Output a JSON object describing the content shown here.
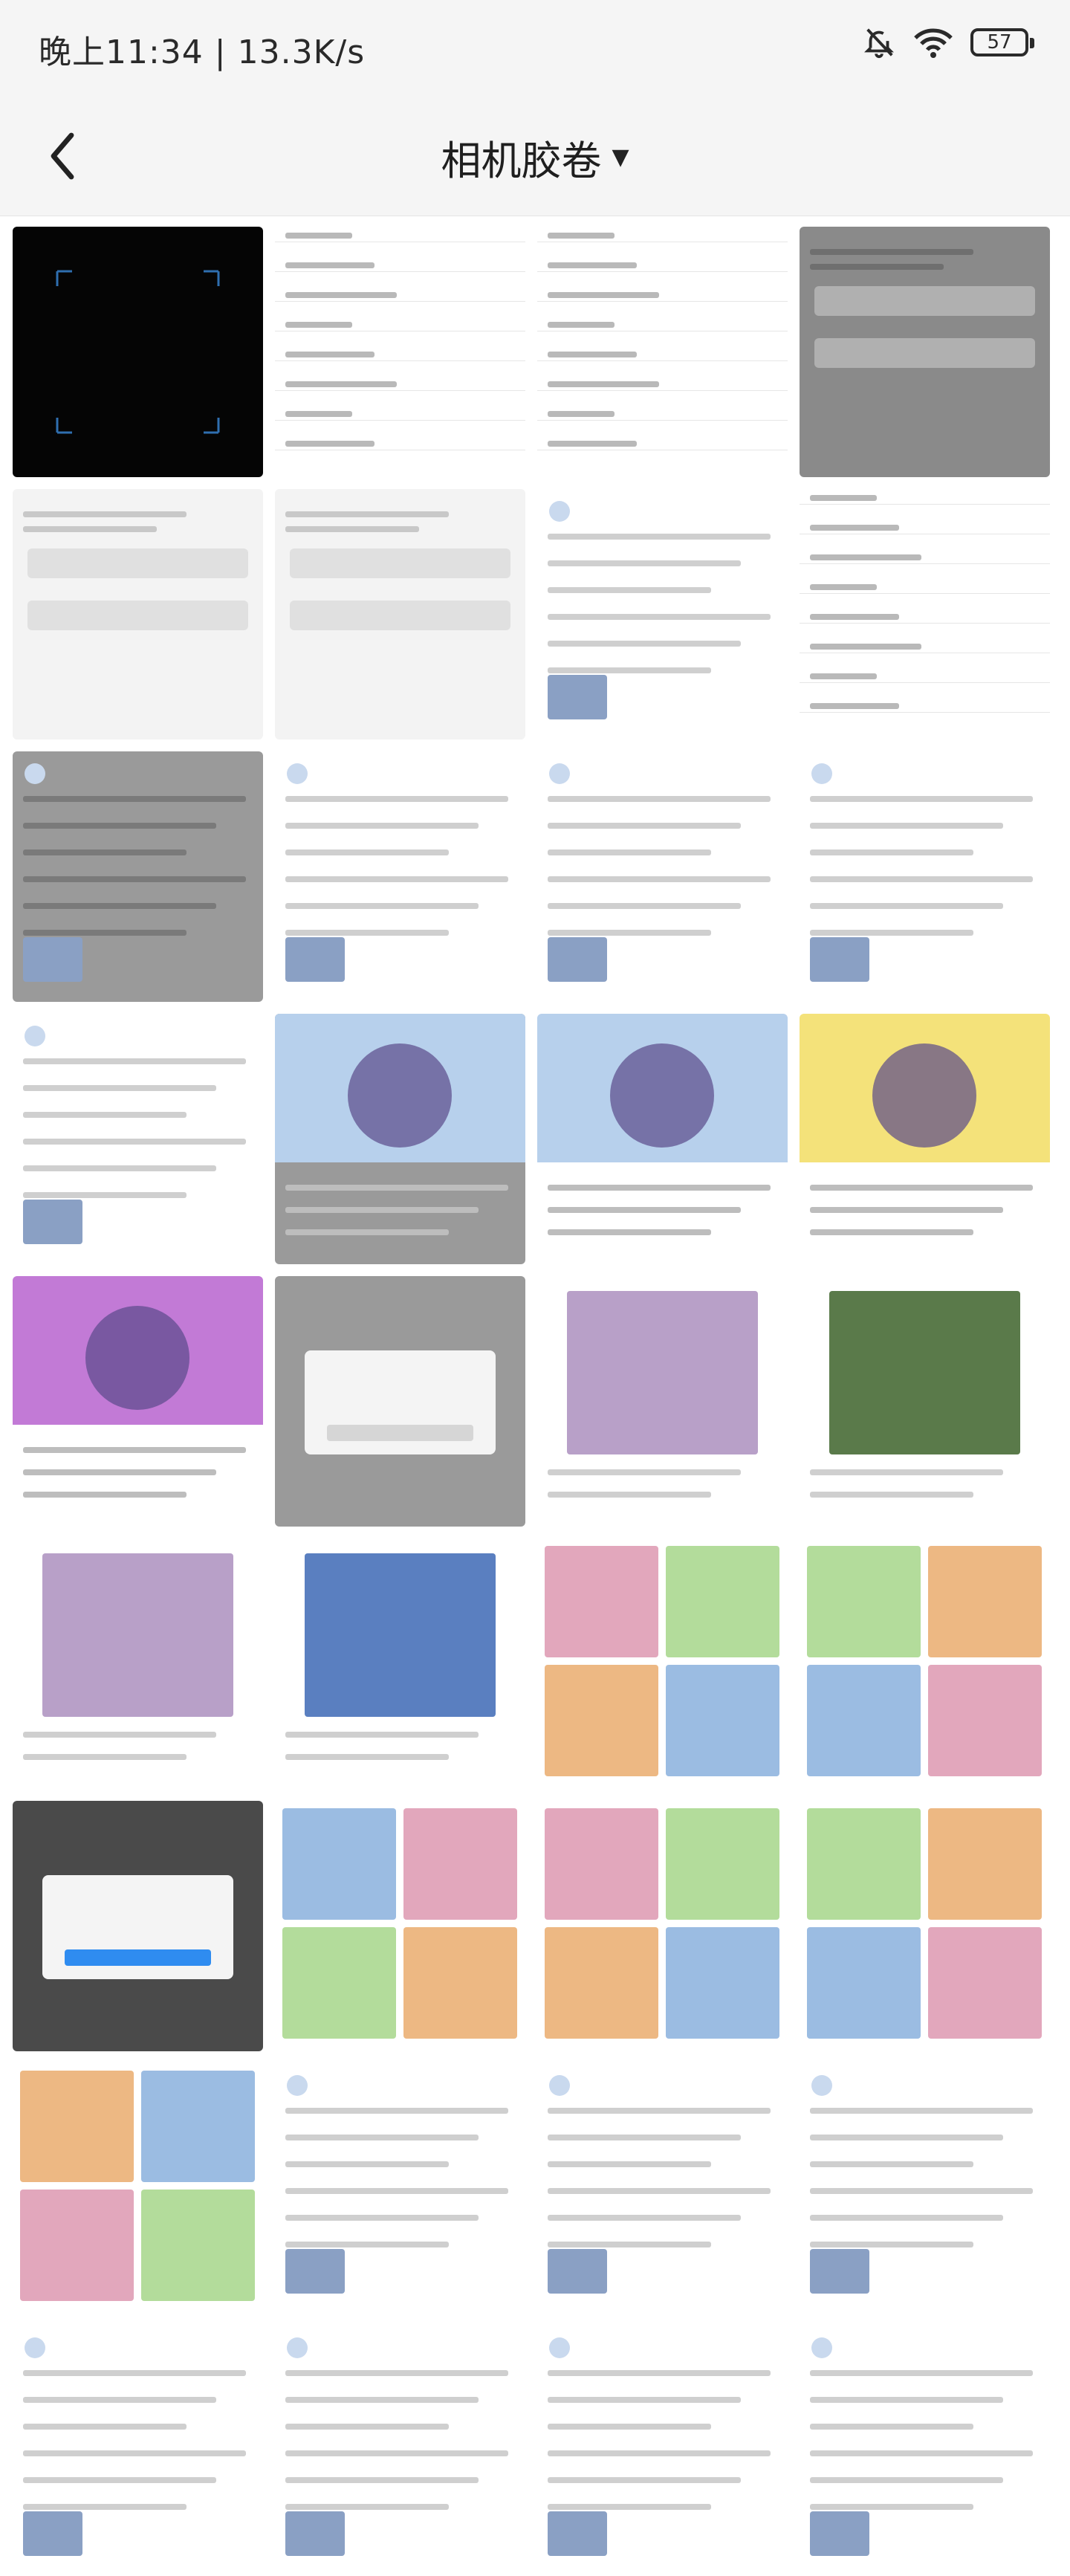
{
  "status_bar": {
    "time": "晚上11:34 | 13.3K/s",
    "battery": "57",
    "icons": [
      "bell-muted-icon",
      "wifi-icon",
      "battery-icon"
    ]
  },
  "header": {
    "back_icon": "chevron-left-icon",
    "title": "相机胶卷",
    "dropdown_icon": "caret-down-icon"
  },
  "grid": {
    "columns": 4,
    "rows": 9,
    "photos": [
      {
        "style": "dark"
      },
      {
        "style": "settings"
      },
      {
        "style": "settings"
      },
      {
        "style": "gray"
      },
      {
        "style": "form"
      },
      {
        "style": "form"
      },
      {
        "style": "feed"
      },
      {
        "style": "list"
      },
      {
        "style": "feed-dim"
      },
      {
        "style": "feed"
      },
      {
        "style": "feed"
      },
      {
        "style": "feed"
      },
      {
        "style": "feed"
      },
      {
        "style": "art-dim"
      },
      {
        "style": "art"
      },
      {
        "style": "art-yellow"
      },
      {
        "style": "art-purple"
      },
      {
        "style": "dialog-dim"
      },
      {
        "style": "photo"
      },
      {
        "style": "photo-green"
      },
      {
        "style": "photo"
      },
      {
        "style": "photo-blue"
      },
      {
        "style": "comic"
      },
      {
        "style": "comic"
      },
      {
        "style": "dialog-dark"
      },
      {
        "style": "comic"
      },
      {
        "style": "comic"
      },
      {
        "style": "card"
      },
      {
        "style": "game"
      },
      {
        "style": "feed"
      },
      {
        "style": "feed"
      },
      {
        "style": "menu"
      },
      {
        "style": "feed"
      },
      {
        "style": "feed"
      },
      {
        "style": "feed"
      },
      {
        "style": "feed"
      }
    ]
  },
  "theme": {
    "accent": "#2f8cf0",
    "background": "#f5f5f5"
  }
}
